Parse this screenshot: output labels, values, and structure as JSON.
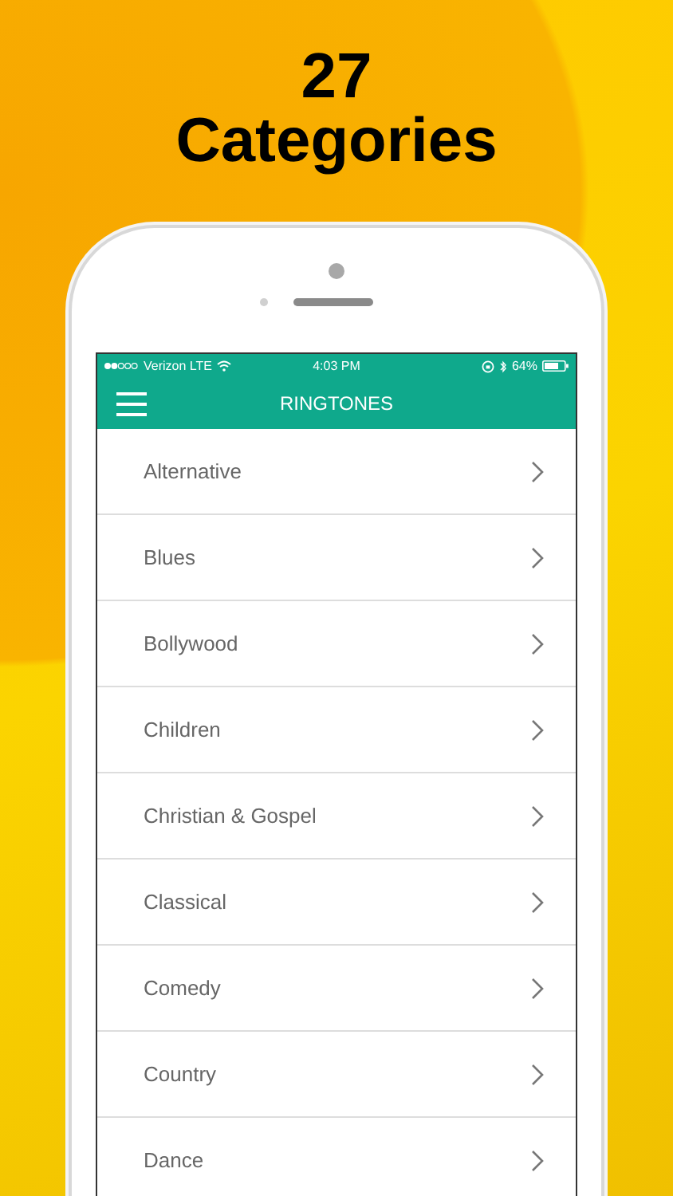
{
  "headline": {
    "count": "27",
    "title": "Categories"
  },
  "status_bar": {
    "carrier": "Verizon LTE",
    "time": "4:03 PM",
    "battery": "64%"
  },
  "header": {
    "title": "RINGTONES"
  },
  "categories": [
    {
      "label": "Alternative"
    },
    {
      "label": "Blues"
    },
    {
      "label": "Bollywood"
    },
    {
      "label": "Children"
    },
    {
      "label": "Christian & Gospel"
    },
    {
      "label": "Classical"
    },
    {
      "label": "Comedy"
    },
    {
      "label": "Country"
    },
    {
      "label": "Dance"
    }
  ]
}
